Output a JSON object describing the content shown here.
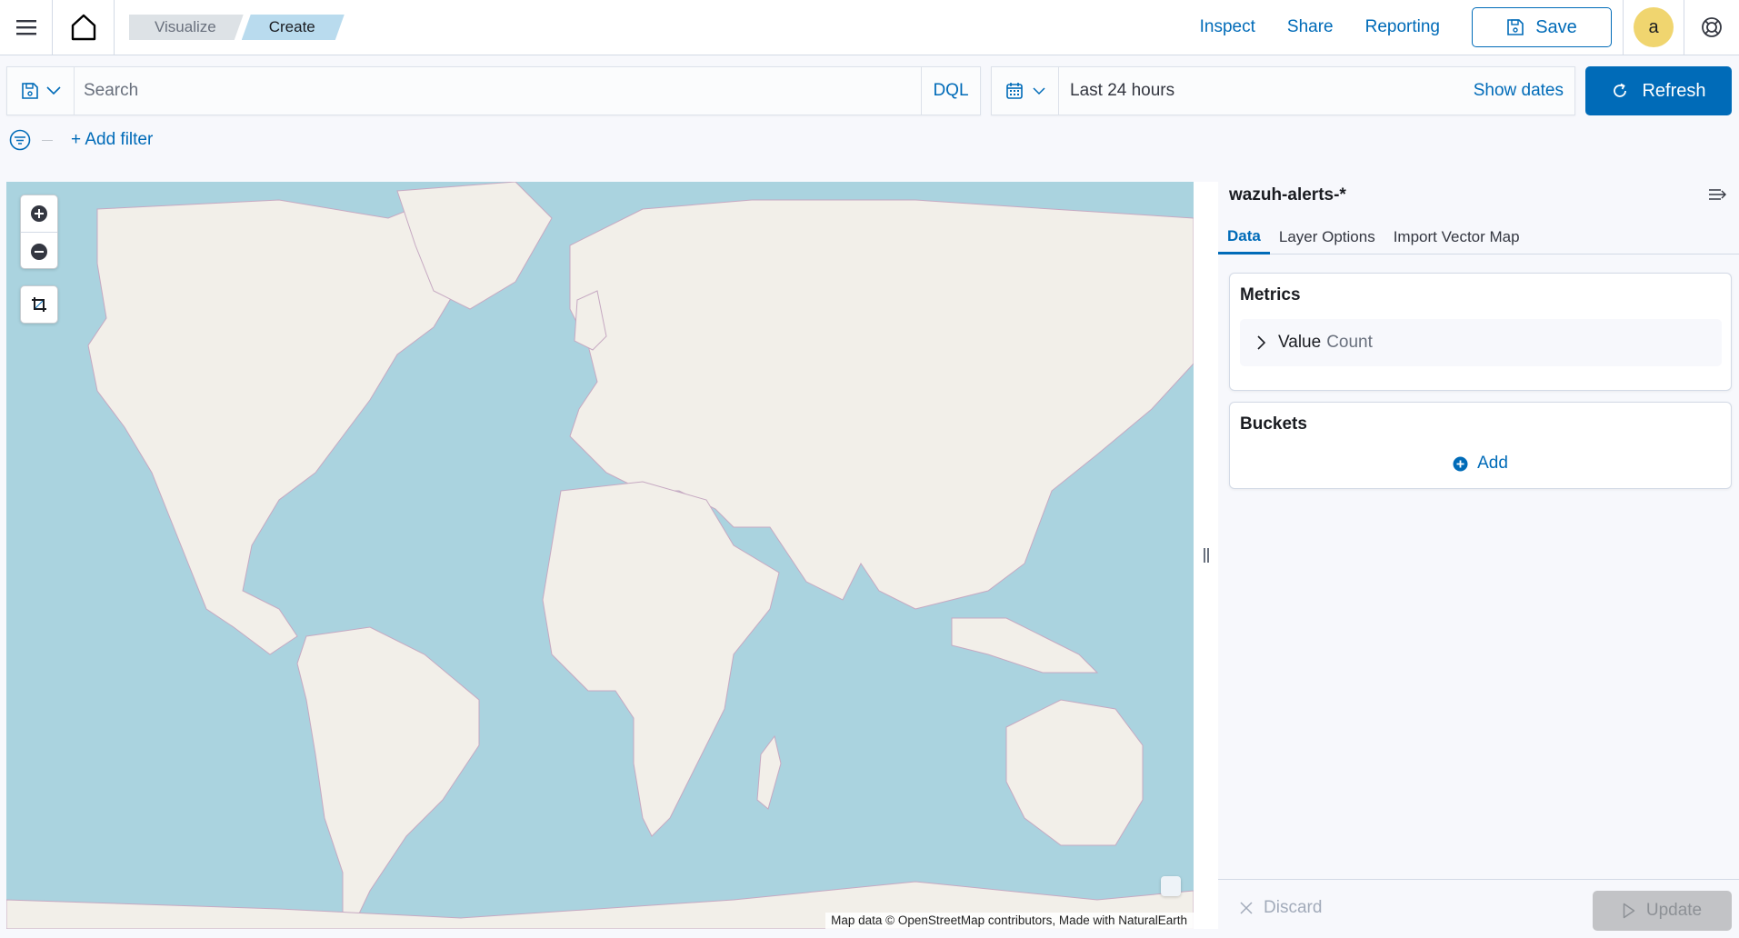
{
  "header": {
    "breadcrumbs": [
      "Visualize",
      "Create"
    ],
    "links": {
      "inspect": "Inspect",
      "share": "Share",
      "reporting": "Reporting"
    },
    "save_label": "Save",
    "avatar_initial": "a"
  },
  "query": {
    "search_placeholder": "Search",
    "search_value": "",
    "language": "DQL",
    "time_range": "Last 24 hours",
    "show_dates_label": "Show dates",
    "refresh_label": "Refresh"
  },
  "filters": {
    "add_filter_label": "+ Add filter"
  },
  "map": {
    "attribution": "Map data © OpenStreetMap contributors, Made with NaturalEarth",
    "colors": {
      "water": "#aad3df",
      "land": "#f2efe9",
      "border": "#c6a9c2"
    }
  },
  "sidebar": {
    "index_pattern": "wazuh-alerts-*",
    "tabs": [
      {
        "label": "Data",
        "active": true
      },
      {
        "label": "Layer Options",
        "active": false
      },
      {
        "label": "Import Vector Map",
        "active": false
      }
    ],
    "metrics": {
      "title": "Metrics",
      "items": [
        {
          "label": "Value",
          "aggregation": "Count"
        }
      ]
    },
    "buckets": {
      "title": "Buckets",
      "add_label": "Add"
    },
    "footer": {
      "discard_label": "Discard",
      "update_label": "Update"
    }
  },
  "colors": {
    "accent": "#006bb8",
    "breadcrumb_active": "#b9dbee",
    "avatar": "#f0d56f"
  }
}
